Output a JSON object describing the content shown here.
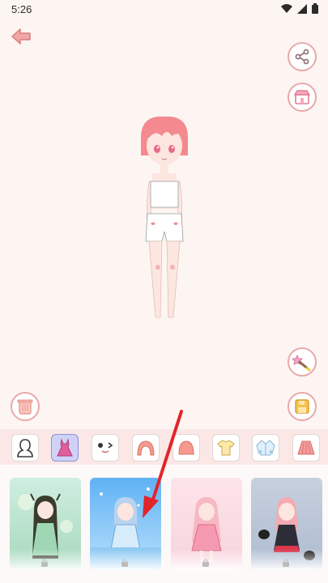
{
  "status_bar": {
    "time": "5:26",
    "icons": [
      "wifi-icon",
      "signal-icon",
      "battery-icon"
    ]
  },
  "toolbar": {
    "back_icon": "back-arrow-icon",
    "share_icon": "share-icon",
    "shop_icon": "shop-icon",
    "magic_icon": "magic-wand-icon",
    "trash_icon": "trash-icon",
    "save_icon": "save-icon"
  },
  "categories": [
    {
      "name": "body",
      "icon": "body-silhouette-icon",
      "selected": false
    },
    {
      "name": "dress",
      "icon": "dress-icon",
      "selected": true
    },
    {
      "name": "face",
      "icon": "face-expression-icon",
      "selected": false
    },
    {
      "name": "hair-front",
      "icon": "hair-front-icon",
      "selected": false
    },
    {
      "name": "hair-back",
      "icon": "hair-back-icon",
      "selected": false
    },
    {
      "name": "shirt",
      "icon": "tshirt-icon",
      "selected": false
    },
    {
      "name": "jacket",
      "icon": "jacket-icon",
      "selected": false
    },
    {
      "name": "skirt",
      "icon": "skirt-icon",
      "selected": false
    }
  ],
  "outfits": [
    {
      "name": "green-fairy",
      "theme": "#bfe6d2",
      "locked": true
    },
    {
      "name": "ice-princess",
      "theme": "#4fa3f0",
      "locked": true
    },
    {
      "name": "pink-lolita",
      "theme": "#f9cfd8",
      "locked": true
    },
    {
      "name": "black-cat",
      "theme": "#c9d2df",
      "locked": true
    }
  ],
  "colors": {
    "accent": "#e9a8a8",
    "selected_category": "#cfd2f6",
    "arrow": "#e0262b"
  }
}
